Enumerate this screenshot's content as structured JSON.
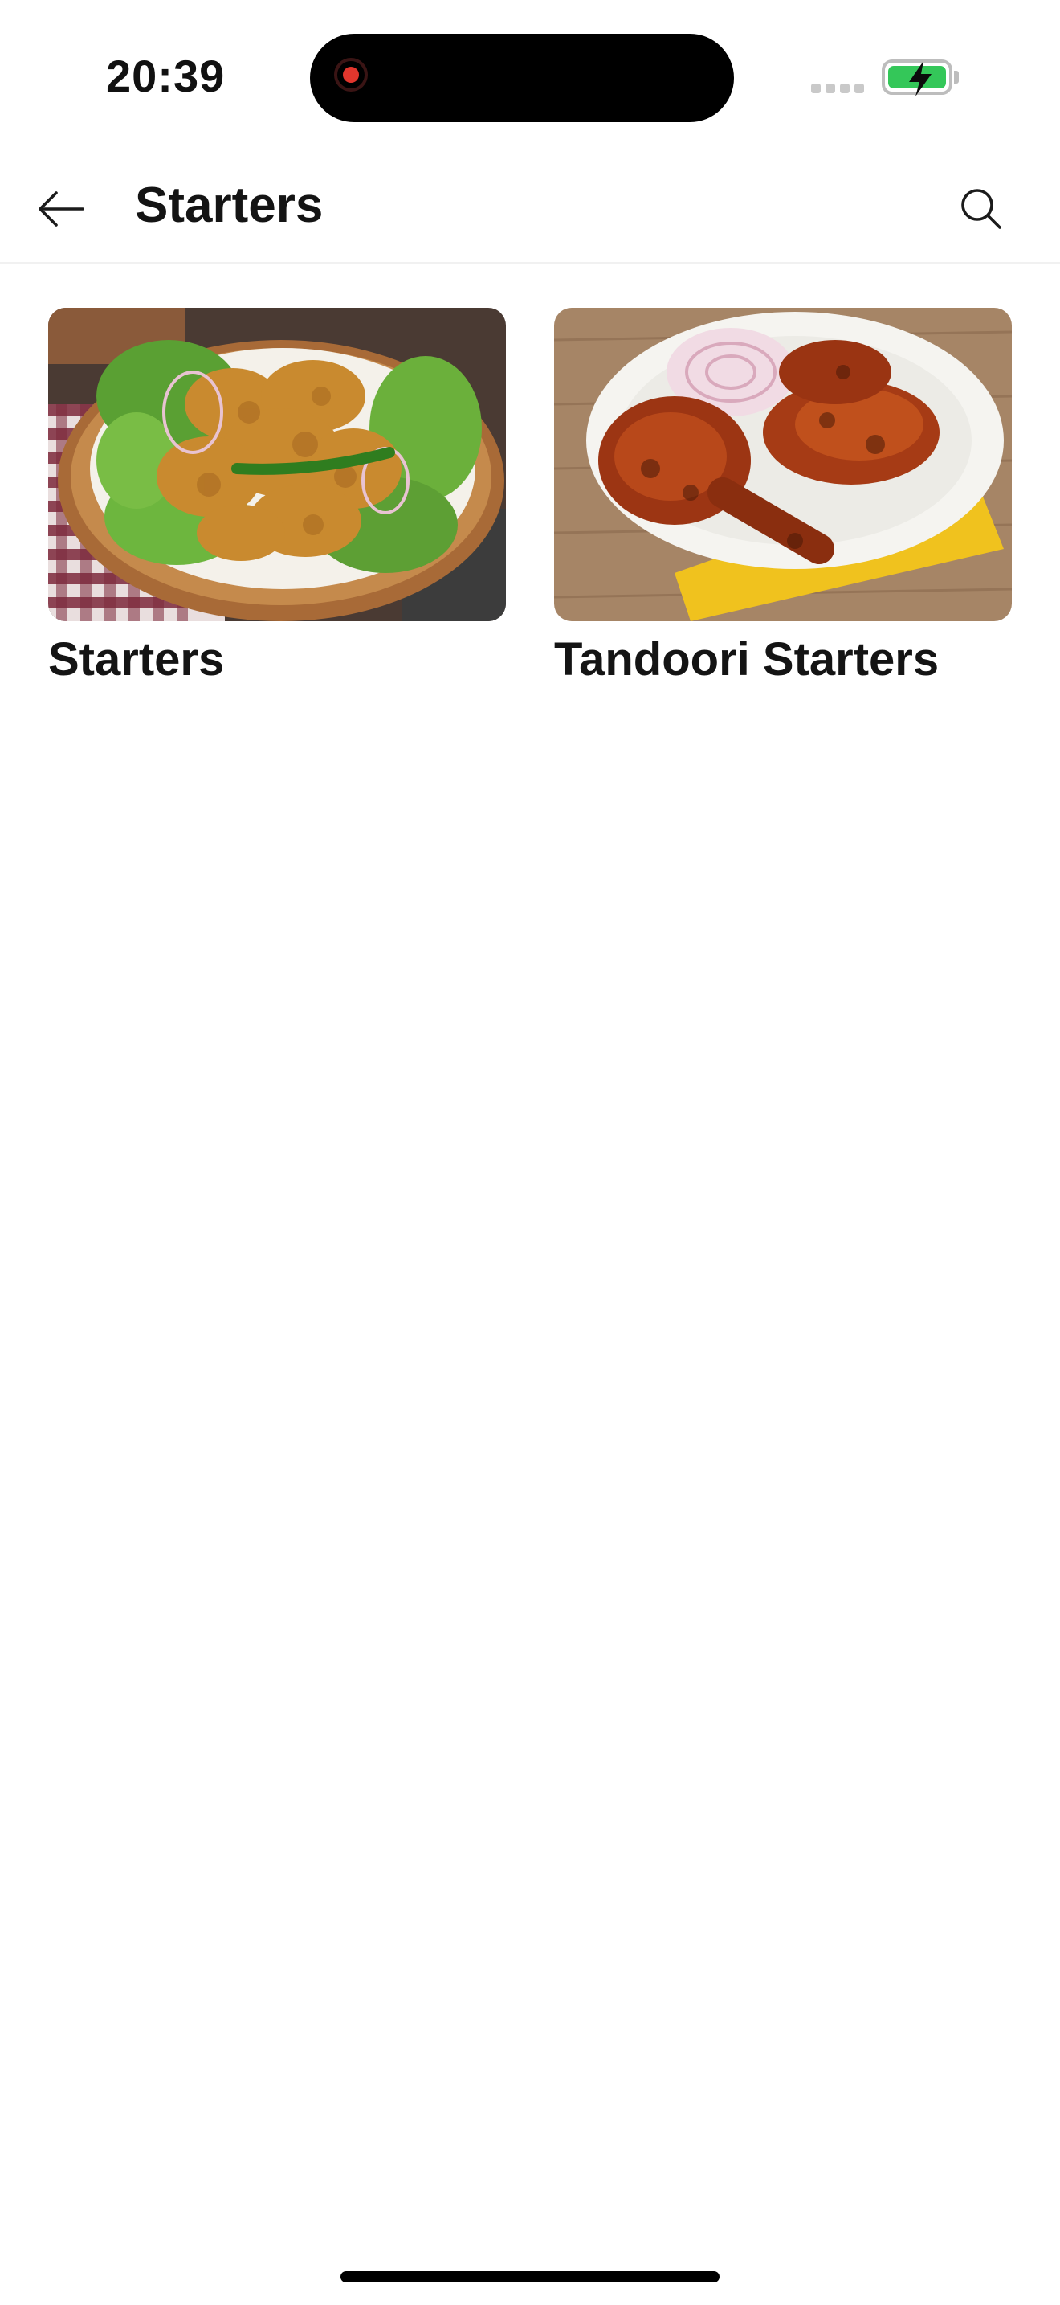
{
  "status_bar": {
    "time": "20:39",
    "icons": [
      "screen-recording-icon",
      "cellular-signal-icon",
      "battery-charging-icon"
    ],
    "battery_color": "#34c759",
    "recording_color": "#e2362d"
  },
  "header": {
    "title": "Starters",
    "back_icon": "arrow-left-icon",
    "search_icon": "search-icon"
  },
  "categories": [
    {
      "label": "Starters",
      "image": "pakora-basket-photo"
    },
    {
      "label": "Tandoori Starters",
      "image": "tandoori-chicken-photo"
    }
  ]
}
